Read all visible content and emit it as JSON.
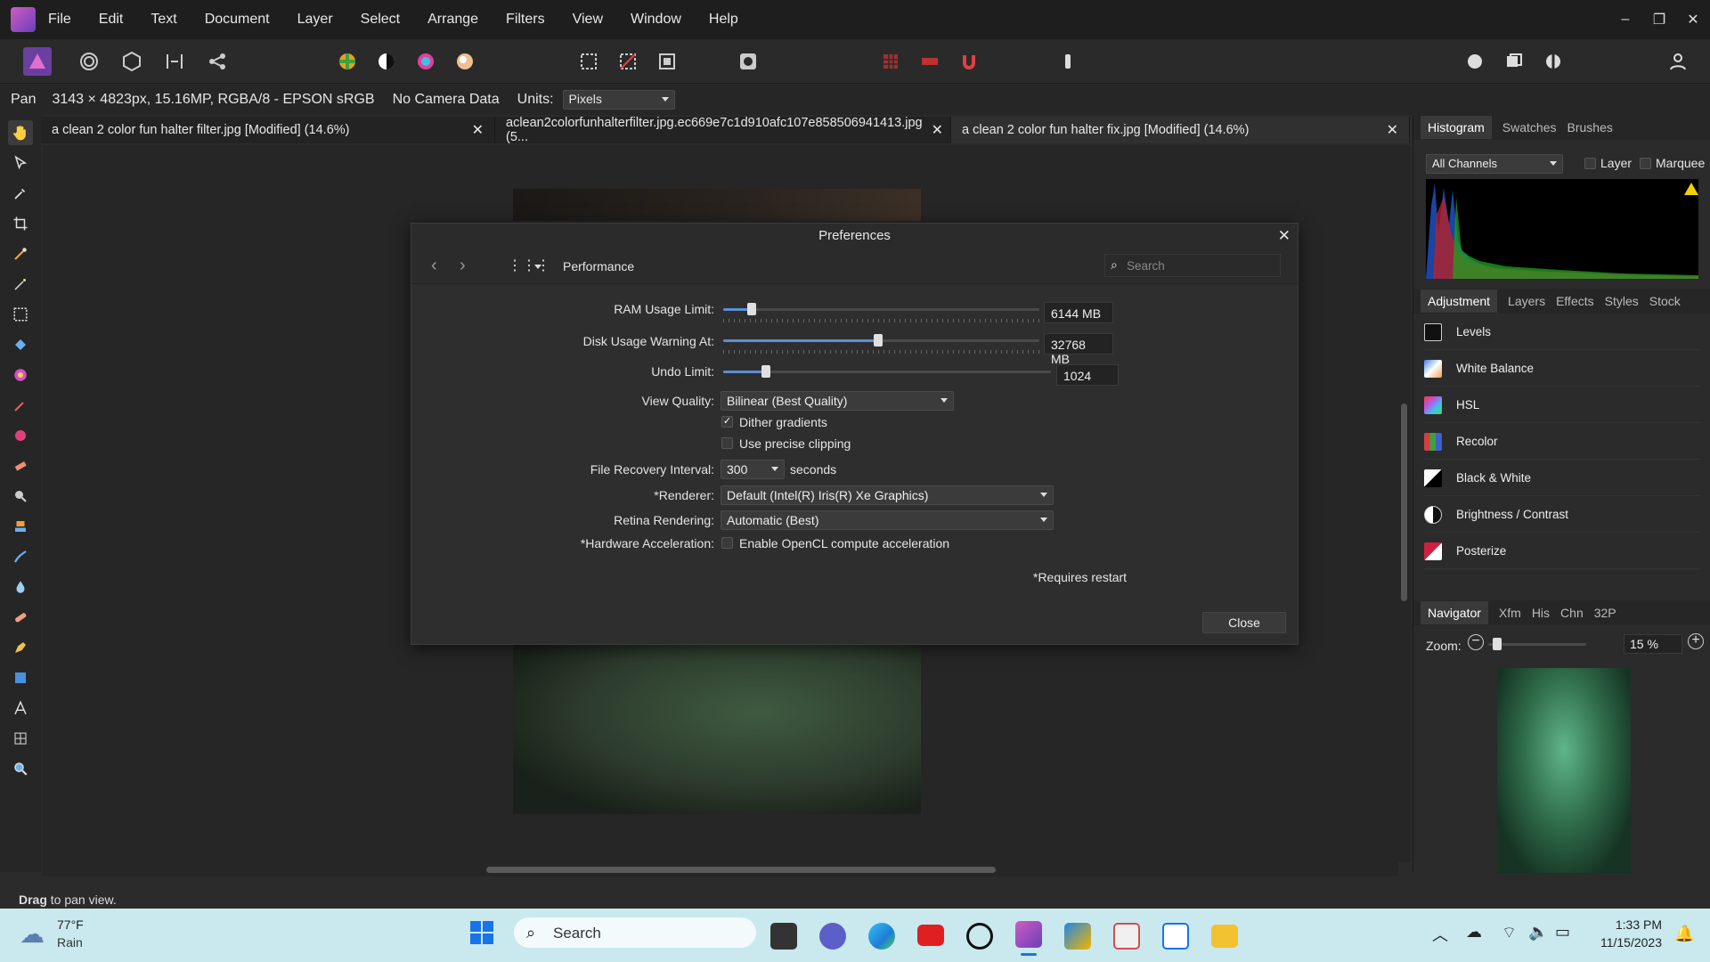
{
  "menu": [
    "File",
    "Edit",
    "Text",
    "Document",
    "Layer",
    "Select",
    "Arrange",
    "Filters",
    "View",
    "Window",
    "Help"
  ],
  "context": {
    "tool": "Pan",
    "doc_info": "3143 × 4823px, 15.16MP, RGBA/8 - EPSON  sRGB",
    "camera": "No Camera Data",
    "units_label": "Units:",
    "units_value": "Pixels"
  },
  "tabs": [
    {
      "label": "a clean 2 color fun halter filter.jpg [Modified] (14.6%)"
    },
    {
      "label": "aclean2colorfunhalterfilter.jpg.ec669e7c1d910afc107e858506941413.jpg (5..."
    },
    {
      "label": "a clean 2 color fun halter fix.jpg [Modified] (14.6%)"
    }
  ],
  "right_panel": {
    "tabs_top": [
      "Histogram",
      "Swatches",
      "Brushes"
    ],
    "channel": "All Channels",
    "layer_label": "Layer",
    "marquee_label": "Marquee",
    "tabs_mid": [
      "Adjustment",
      "Layers",
      "Effects",
      "Styles",
      "Stock"
    ],
    "adjustments": [
      {
        "label": "Levels",
        "color": "#ffffff"
      },
      {
        "label": "White Balance",
        "color": "#f0a050"
      },
      {
        "label": "HSL",
        "color": "#c050e0"
      },
      {
        "label": "Recolor",
        "color": "#d04040"
      },
      {
        "label": "Black & White",
        "color": "#ffffff"
      },
      {
        "label": "Brightness / Contrast",
        "color": "#ffffff"
      },
      {
        "label": "Posterize",
        "color": "#d02040"
      }
    ],
    "tabs_bottom": [
      "Navigator",
      "Xfm",
      "His",
      "Chn",
      "32P"
    ],
    "zoom_label": "Zoom:",
    "zoom_value": "15 %"
  },
  "dialog": {
    "title": "Preferences",
    "section": "Performance",
    "search_placeholder": "Search",
    "ram_label": "RAM Usage Limit:",
    "ram_value": "6144 MB",
    "ram_fraction": 0.09,
    "disk_label": "Disk Usage Warning At:",
    "disk_value": "32768 MB",
    "disk_fraction": 0.49,
    "undo_label": "Undo Limit:",
    "undo_value": "1024",
    "undo_fraction": 0.13,
    "view_quality_label": "View Quality:",
    "view_quality_value": "Bilinear (Best Quality)",
    "dither_label": "Dither gradients",
    "dither_checked": true,
    "precise_label": "Use precise clipping",
    "precise_checked": false,
    "recovery_label": "File Recovery Interval:",
    "recovery_value": "300",
    "recovery_unit": "seconds",
    "renderer_label": "*Renderer:",
    "renderer_value": "Default (Intel(R) Iris(R) Xe Graphics)",
    "retina_label": "Retina Rendering:",
    "retina_value": "Automatic (Best)",
    "hw_label": "*Hardware Acceleration:",
    "hw_option": "Enable OpenCL compute acceleration",
    "restart_note": "*Requires restart",
    "close_label": "Close"
  },
  "status_bar": {
    "bold": "Drag",
    "rest": " to pan view."
  },
  "taskbar": {
    "temp": "77°F",
    "weather": "Rain",
    "search": "Search",
    "time": "1:33 PM",
    "date": "11/15/2023"
  }
}
